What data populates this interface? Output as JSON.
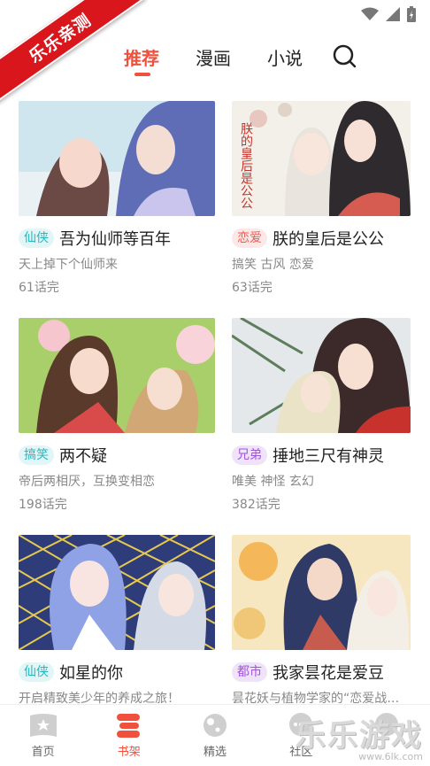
{
  "watermark": {
    "ribbon": "乐乐亲测",
    "brand": "乐乐游戏",
    "url": "www.6lk.com"
  },
  "tabs": [
    {
      "label": "推荐",
      "active": true
    },
    {
      "label": "漫画",
      "active": false
    },
    {
      "label": "小说",
      "active": false
    }
  ],
  "cards": [
    {
      "tag": "仙侠",
      "tag_style": "xianxia",
      "title": "吾为仙师等百年",
      "desc": "天上掉下个仙师来",
      "episodes": "61话完"
    },
    {
      "tag": "恋爱",
      "tag_style": "lianai",
      "title": "朕的皇后是公公",
      "desc": "搞笑 古风 恋爱",
      "episodes": "63话完",
      "cover_text": "朕的皇后是公公"
    },
    {
      "tag": "搞笑",
      "tag_style": "gaoxiao",
      "title": "两不疑",
      "desc": "帝后两相厌，互换变相恋",
      "episodes": "198话完"
    },
    {
      "tag": "兄弟",
      "tag_style": "xiongdi",
      "title": "捶地三尺有神灵",
      "desc": "唯美 神怪 玄幻",
      "episodes": "382话完"
    },
    {
      "tag": "仙侠",
      "tag_style": "xianxia",
      "title": "如星的你",
      "desc": "开启精致美少年的养成之旅！",
      "episodes": ""
    },
    {
      "tag": "都市",
      "tag_style": "dushi",
      "title": "我家昙花是爱豆",
      "desc": "昙花妖与植物学家的“恋爱战…",
      "episodes": ""
    }
  ],
  "bottom_nav": [
    {
      "label": "首页",
      "icon": "home-star-icon",
      "active": false
    },
    {
      "label": "书架",
      "icon": "bookshelf-icon",
      "active": true
    },
    {
      "label": "精选",
      "icon": "featured-icon",
      "active": false
    },
    {
      "label": "社区",
      "icon": "community-chat-icon",
      "active": false
    },
    {
      "label": "我的",
      "icon": "profile-icon",
      "active": false
    }
  ],
  "colors": {
    "accent": "#f0513e"
  }
}
